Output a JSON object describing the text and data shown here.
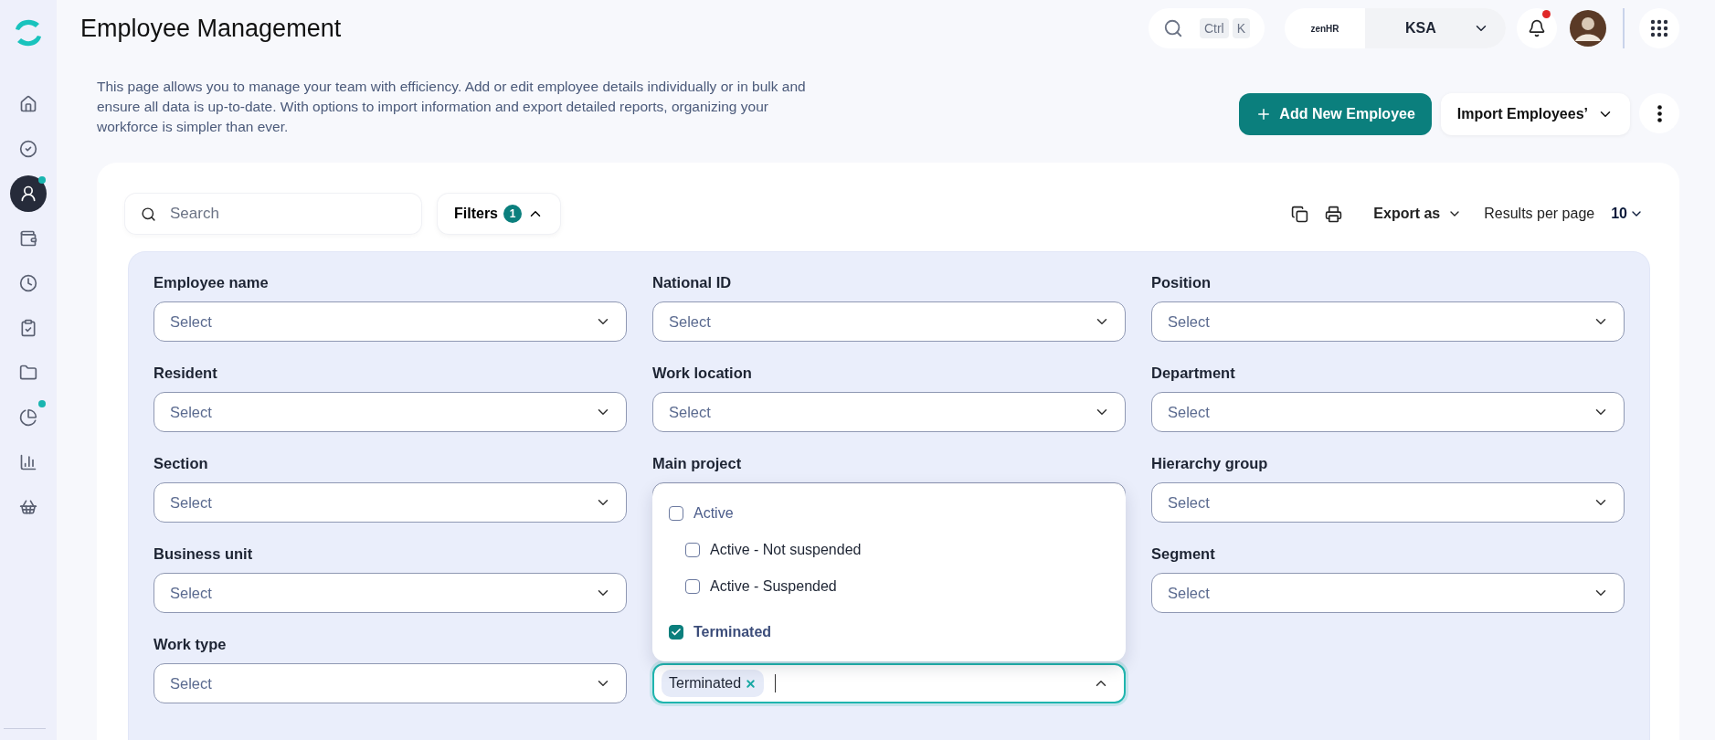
{
  "sidebar": {
    "items": [
      {
        "selected": false,
        "dot": false
      },
      {
        "selected": false,
        "dot": false
      },
      {
        "selected": true,
        "dot": true
      },
      {
        "selected": false,
        "dot": false
      },
      {
        "selected": false,
        "dot": false
      },
      {
        "selected": false,
        "dot": false
      },
      {
        "selected": false,
        "dot": false
      },
      {
        "selected": false,
        "dot": true
      },
      {
        "selected": false,
        "dot": false
      },
      {
        "selected": false,
        "dot": false
      }
    ]
  },
  "header": {
    "title": "Employee Management",
    "search_keys": [
      "Ctrl",
      "K"
    ],
    "brand": "zenHR",
    "country": "KSA",
    "notification_dot": true
  },
  "description": "This page allows you to manage your team with efficiency. Add or edit employee details individually or in bulk and ensure all data is up-to-date. With options to import information and export detailed reports, organizing your workforce is simpler than ever.",
  "actions": {
    "primary": "Add New Employee",
    "import": "Import Employees’"
  },
  "toolbar": {
    "search_placeholder": "Search",
    "filters_label": "Filters",
    "filters_count": "1",
    "filters_expanded": true,
    "export_label": "Export as",
    "results_label": "Results per page",
    "results_value": "10"
  },
  "filter_columns": [
    [
      {
        "kind": "select",
        "label": "Employee name",
        "placeholder": "Select"
      },
      {
        "kind": "select",
        "label": "Resident",
        "placeholder": "Select"
      },
      {
        "kind": "select",
        "label": "Section",
        "placeholder": "Select"
      },
      {
        "kind": "select",
        "label": "Business unit",
        "placeholder": "Select"
      },
      {
        "kind": "select",
        "label": "Work type",
        "placeholder": "Select"
      }
    ],
    [
      {
        "kind": "select",
        "label": "National ID",
        "placeholder": "Select"
      },
      {
        "kind": "select",
        "label": "Work location",
        "placeholder": "Select"
      },
      {
        "kind": "select",
        "label": "Main project"
      },
      {
        "kind": "multiselect",
        "chips": [
          "Terminated"
        ],
        "expanded": true,
        "options": [
          {
            "label": "Active",
            "checked": false,
            "children": [
              {
                "label": "Active - Not suspended",
                "checked": false
              },
              {
                "label": "Active - Suspended",
                "checked": false
              }
            ]
          },
          {
            "label": "Terminated",
            "checked": true
          }
        ]
      }
    ],
    [
      {
        "kind": "select",
        "label": "Position",
        "placeholder": "Select"
      },
      {
        "kind": "select",
        "label": "Department",
        "placeholder": "Select"
      },
      {
        "kind": "select",
        "label": "Hierarchy group",
        "placeholder": "Select"
      },
      {
        "kind": "select",
        "label": "Segment",
        "placeholder": "Select"
      }
    ]
  ]
}
